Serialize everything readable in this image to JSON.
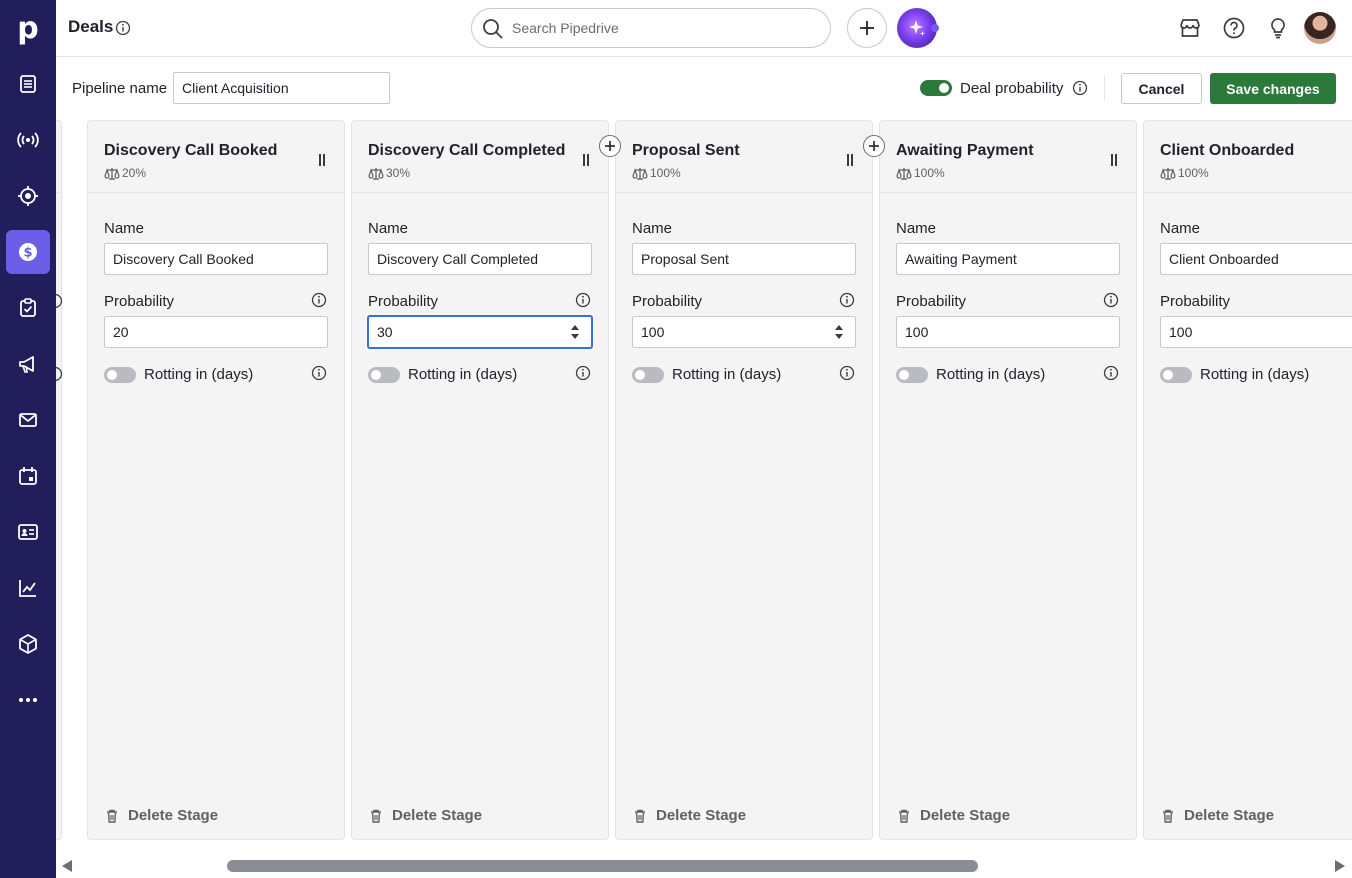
{
  "app": {
    "logo": "p",
    "page_title": "Deals"
  },
  "header": {
    "search_placeholder": "Search Pipedrive"
  },
  "subheader": {
    "pipeline_label": "Pipeline name",
    "pipeline_value": "Client Acquisition",
    "deal_probability_label": "Deal probability",
    "deal_probability_on": true,
    "cancel_label": "Cancel",
    "save_label": "Save changes"
  },
  "labels": {
    "name": "Name",
    "probability": "Probability",
    "rotting": "Rotting in (days)",
    "delete": "Delete Stage"
  },
  "stages": [
    {
      "title": "Discovery Call Booked",
      "prob_display": "20%",
      "name": "Discovery Call Booked",
      "probability": "20"
    },
    {
      "title": "Discovery Call Completed",
      "prob_display": "30%",
      "name": "Discovery Call Completed",
      "probability": "30"
    },
    {
      "title": "Proposal Sent",
      "prob_display": "100%",
      "name": "Proposal Sent",
      "probability": "100"
    },
    {
      "title": "Awaiting Payment",
      "prob_display": "100%",
      "name": "Awaiting Payment",
      "probability": "100"
    },
    {
      "title": "Client Onboarded",
      "prob_display": "100%",
      "name": "Client Onboarded",
      "probability": "100"
    }
  ],
  "colors": {
    "nav_bg": "#221e5b",
    "nav_active": "#6a5ee6",
    "primary_green": "#2b7a3b",
    "focus_blue": "#3670d9"
  },
  "icons": {
    "nav": [
      "leads-icon",
      "broadcast-icon",
      "target-icon",
      "deals-icon",
      "tasks-icon",
      "campaigns-icon",
      "mail-icon",
      "calendar-icon",
      "contacts-icon",
      "insights-icon",
      "products-icon",
      "more-icon"
    ],
    "header": [
      "marketplace-icon",
      "help-icon",
      "lightbulb-icon"
    ]
  }
}
